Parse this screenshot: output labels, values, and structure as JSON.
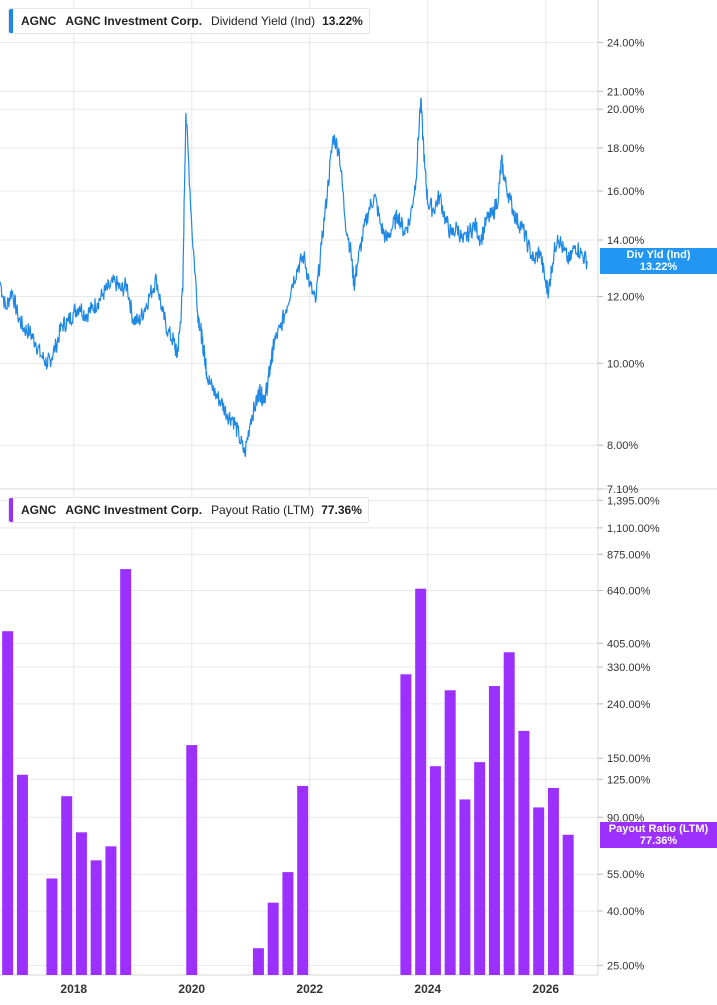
{
  "ticker": "AGNC",
  "company": "AGNC Investment Corp.",
  "colors": {
    "dy": "#1e88e5",
    "flag_dy": "#2196f3",
    "pr": "#9b30ff",
    "flag_pr": "#9b30ff",
    "grid": "#e8e8e8"
  },
  "chart_data": [
    {
      "type": "line",
      "title": "",
      "metric": "Dividend Yield (Ind)",
      "current_value": "13.22%",
      "flag_label": "Div Yld (Ind)",
      "scale": "log",
      "ylim": [
        7.1,
        26.5
      ],
      "yticks": [
        7.1,
        8,
        10,
        12,
        14,
        16,
        18,
        20,
        21,
        24
      ],
      "ytick_labels": [
        "7.10%",
        "8.00%",
        "10.00%",
        "12.00%",
        "14.00%",
        "16.00%",
        "18.00%",
        "20.00%",
        "21.00%",
        "24.00%"
      ],
      "x_range": [
        2016.75,
        2026.75
      ],
      "x": [
        2016.75,
        2016.85,
        2016.95,
        2017.05,
        2017.15,
        2017.25,
        2017.35,
        2017.45,
        2017.55,
        2017.6,
        2017.7,
        2017.8,
        2017.9,
        2018.0,
        2018.1,
        2018.2,
        2018.3,
        2018.4,
        2018.5,
        2018.6,
        2018.7,
        2018.8,
        2018.9,
        2019.0,
        2019.1,
        2019.2,
        2019.3,
        2019.4,
        2019.5,
        2019.6,
        2019.7,
        2019.75,
        2019.8,
        2019.85,
        2019.9,
        2020.0,
        2020.1,
        2020.15,
        2020.18,
        2020.21,
        2020.23,
        2020.25,
        2020.3,
        2020.4,
        2020.5,
        2020.6,
        2020.7,
        2020.8,
        2020.9,
        2021.0,
        2021.1,
        2021.15,
        2021.2,
        2021.25,
        2021.28,
        2021.32,
        2021.36,
        2021.4,
        2021.5,
        2021.6,
        2021.7,
        2021.8,
        2021.9,
        2022.0,
        2022.1,
        2022.2,
        2022.3,
        2022.4,
        2022.5,
        2022.6,
        2022.7,
        2022.75,
        2022.8,
        2022.9,
        2023.0,
        2023.1,
        2023.2,
        2023.3,
        2023.4,
        2023.5,
        2023.6,
        2023.7,
        2023.8,
        2023.88,
        2023.95,
        2024.0,
        2024.1,
        2024.2,
        2024.3,
        2024.4,
        2024.5,
        2024.6,
        2024.7,
        2024.8,
        2024.9,
        2025.0,
        2025.1,
        2025.2,
        2025.25,
        2025.3,
        2025.4,
        2025.5,
        2025.6,
        2025.7,
        2025.8,
        2025.9,
        2026.0,
        2026.05,
        2026.1,
        2026.2,
        2026.3,
        2026.4,
        2026.5,
        2026.6,
        2026.7
      ],
      "y": [
        12.5,
        11.6,
        12.2,
        11.4,
        11.0,
        10.9,
        10.6,
        10.2,
        10.0,
        10.1,
        10.5,
        11.1,
        11.2,
        11.5,
        11.7,
        11.4,
        11.6,
        11.8,
        12.1,
        12.3,
        12.5,
        12.2,
        12.4,
        11.3,
        11.2,
        11.6,
        12.1,
        12.6,
        11.5,
        10.9,
        10.6,
        10.2,
        11.0,
        12.3,
        19.8,
        14.5,
        11.5,
        11.0,
        10.6,
        10.3,
        10.1,
        9.8,
        9.5,
        9.2,
        9.0,
        8.7,
        8.6,
        8.2,
        7.8,
        8.6,
        9.0,
        9.3,
        9.1,
        9.2,
        9.4,
        9.8,
        10.2,
        10.6,
        11.0,
        11.6,
        12.4,
        13.0,
        13.4,
        12.4,
        11.8,
        13.8,
        16.0,
        18.6,
        17.8,
        14.8,
        13.5,
        12.4,
        13.0,
        14.2,
        15.2,
        15.8,
        14.6,
        14.0,
        14.5,
        15.0,
        14.3,
        14.8,
        16.5,
        20.5,
        17.0,
        15.5,
        15.2,
        15.8,
        14.8,
        14.2,
        14.5,
        13.9,
        14.3,
        14.6,
        14.0,
        14.8,
        15.0,
        15.8,
        17.4,
        16.5,
        15.6,
        14.8,
        14.5,
        13.8,
        13.2,
        13.6,
        12.4,
        12.2,
        13.0,
        14.2,
        13.6,
        13.2,
        13.8,
        13.5,
        13.22
      ]
    },
    {
      "type": "bar",
      "title": "",
      "metric": "Payout Ratio (LTM)",
      "current_value": "77.36%",
      "flag_label": "Payout Ratio (LTM)",
      "scale": "log",
      "ylim": [
        23,
        1500
      ],
      "yticks": [
        25,
        40,
        55,
        90,
        125,
        150,
        240,
        330,
        405,
        640,
        875,
        1100,
        1395
      ],
      "ytick_labels": [
        "25.00%",
        "40.00%",
        "55.00%",
        "90.00%",
        "125.00%",
        "150.00%",
        "240.00%",
        "330.00%",
        "405.00%",
        "640.00%",
        "875.00%",
        "1,100.00%",
        "1,395.00%"
      ],
      "x_range": [
        2016.75,
        2026.75
      ],
      "x": [
        2016.88,
        2017.13,
        2017.63,
        2017.88,
        2018.13,
        2018.38,
        2018.63,
        2018.88,
        2020.0,
        2021.13,
        2021.38,
        2021.63,
        2021.88,
        2023.63,
        2023.88,
        2024.13,
        2024.38,
        2024.63,
        2024.88,
        2025.13,
        2025.38,
        2025.63,
        2025.88,
        2026.13,
        2026.38
      ],
      "values": [
        450,
        130,
        53,
        108,
        79,
        62,
        70,
        770,
        168,
        29,
        43,
        56,
        118,
        310,
        650,
        140,
        270,
        105,
        145,
        280,
        375,
        190,
        98,
        116,
        77.36
      ]
    }
  ],
  "x_axis": {
    "ticks": [
      2018,
      2020,
      2022,
      2024,
      2026
    ],
    "labels": [
      "2018",
      "2020",
      "2022",
      "2024",
      "2026"
    ]
  }
}
